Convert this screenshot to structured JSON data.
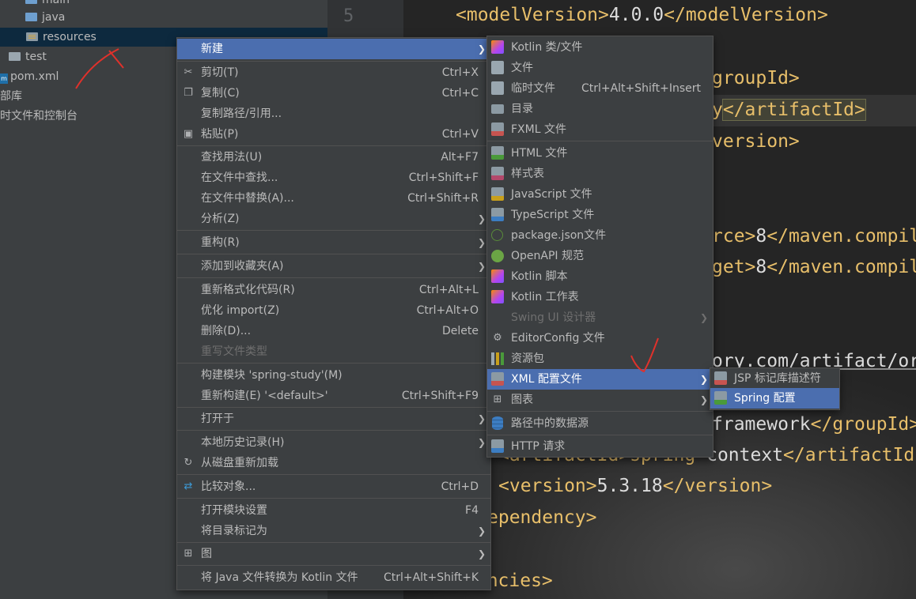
{
  "tree": {
    "items": [
      {
        "label": "main",
        "icon": "folder-icon"
      },
      {
        "label": "java",
        "icon": "folder-icon"
      },
      {
        "label": "resources",
        "icon": "resources-folder-icon"
      },
      {
        "label": "test",
        "icon": "folder-icon"
      },
      {
        "label": "pom.xml",
        "icon": "maven-file-icon"
      },
      {
        "label": "外部库",
        "icon": "library-icon"
      },
      {
        "label": "临时文件和控制台",
        "icon": "scratch-icon"
      }
    ]
  },
  "editor": {
    "line_number": "5",
    "lines": [
      {
        "open": "<modelVersion>",
        "text": "4.0.0",
        "close": "</modelVersion>"
      },
      {
        "frag": "groupId>"
      },
      {
        "frag_a": "y",
        "frag_b": "</artifactId>"
      },
      {
        "frag": "version>"
      },
      {
        "frag_a": "rce>",
        "num": "8",
        "frag_b": "</maven.compil"
      },
      {
        "frag_a": "get>",
        "num": "8",
        "frag_b": "</maven.compil"
      },
      {
        "frag": "ory.com/artifact/or"
      },
      {
        "frag_a": "framework",
        "frag_b": "</groupId>"
      },
      {
        "frag_a": "<artifactId>spring-",
        "frag_b": "context",
        "frag_c": "</artifactId"
      },
      {
        "open": "<version>",
        "text": "5.3.18",
        "close": "</version>"
      },
      {
        "frag": "ependency>"
      },
      {
        "frag": "dencies>"
      }
    ]
  },
  "context_menu": {
    "items": [
      {
        "label": "新建",
        "shortcut": "",
        "submenu": true
      },
      {
        "label": "剪切(T)",
        "shortcut": "Ctrl+X",
        "icon": "scissors-icon"
      },
      {
        "label": "复制(C)",
        "shortcut": "Ctrl+C",
        "icon": "copy-icon"
      },
      {
        "label": "复制路径/引用...",
        "shortcut": ""
      },
      {
        "label": "粘贴(P)",
        "shortcut": "Ctrl+V",
        "icon": "paste-icon"
      },
      {
        "label": "查找用法(U)",
        "shortcut": "Alt+F7"
      },
      {
        "label": "在文件中查找...",
        "shortcut": "Ctrl+Shift+F"
      },
      {
        "label": "在文件中替换(A)...",
        "shortcut": "Ctrl+Shift+R"
      },
      {
        "label": "分析(Z)",
        "shortcut": "",
        "submenu": true
      },
      {
        "label": "重构(R)",
        "shortcut": "",
        "submenu": true
      },
      {
        "label": "添加到收藏夹(A)",
        "shortcut": "",
        "submenu": true
      },
      {
        "label": "重新格式化代码(R)",
        "shortcut": "Ctrl+Alt+L"
      },
      {
        "label": "优化 import(Z)",
        "shortcut": "Ctrl+Alt+O"
      },
      {
        "label": "删除(D)...",
        "shortcut": "Delete"
      },
      {
        "label": "重写文件类型",
        "shortcut": "",
        "disabled": true
      },
      {
        "label": "构建模块 'spring-study'(M)",
        "shortcut": ""
      },
      {
        "label": "重新构建(E) '<default>'",
        "shortcut": "Ctrl+Shift+F9"
      },
      {
        "label": "打开于",
        "shortcut": "",
        "submenu": true
      },
      {
        "label": "本地历史记录(H)",
        "shortcut": "",
        "submenu": true
      },
      {
        "label": "从磁盘重新加载",
        "shortcut": "",
        "icon": "reload-icon"
      },
      {
        "label": "比较对象...",
        "shortcut": "Ctrl+D",
        "icon": "compare-icon"
      },
      {
        "label": "打开模块设置",
        "shortcut": "F4"
      },
      {
        "label": "将目录标记为",
        "shortcut": "",
        "submenu": true
      },
      {
        "label": "图",
        "shortcut": "",
        "submenu": true,
        "icon": "diagram-icon"
      },
      {
        "label": "将 Java 文件转换为 Kotlin 文件",
        "shortcut": "Ctrl+Alt+Shift+K"
      }
    ]
  },
  "new_menu": {
    "items": [
      {
        "label": "Kotlin 类/文件",
        "shortcut": "",
        "icon": "kotlin-icon"
      },
      {
        "label": "文件",
        "shortcut": "",
        "icon": "file-icon"
      },
      {
        "label": "临时文件",
        "shortcut": "Ctrl+Alt+Shift+Insert",
        "icon": "scratch-file-icon"
      },
      {
        "label": "目录",
        "shortcut": "",
        "icon": "folder-icon"
      },
      {
        "label": "FXML 文件",
        "shortcut": "",
        "icon": "fxml-icon"
      },
      {
        "label": "HTML 文件",
        "shortcut": "",
        "icon": "html-icon"
      },
      {
        "label": "样式表",
        "shortcut": "",
        "icon": "css-icon"
      },
      {
        "label": "JavaScript 文件",
        "shortcut": "",
        "icon": "js-icon"
      },
      {
        "label": "TypeScript 文件",
        "shortcut": "",
        "icon": "ts-icon"
      },
      {
        "label": "package.json文件",
        "shortcut": "",
        "icon": "nodejs-icon"
      },
      {
        "label": "OpenAPI 规范",
        "shortcut": "",
        "icon": "openapi-icon"
      },
      {
        "label": "Kotlin 脚本",
        "shortcut": "",
        "icon": "kotlin-script-icon"
      },
      {
        "label": "Kotlin 工作表",
        "shortcut": "",
        "icon": "kotlin-worksheet-icon"
      },
      {
        "label": "Swing UI 设计器",
        "shortcut": "",
        "disabled": true,
        "submenu": true
      },
      {
        "label": "EditorConfig 文件",
        "shortcut": "",
        "icon": "gear-icon"
      },
      {
        "label": "资源包",
        "shortcut": "",
        "icon": "resource-bundle-icon"
      },
      {
        "label": "XML 配置文件",
        "shortcut": "",
        "submenu": true,
        "icon": "xml-icon"
      },
      {
        "label": "图表",
        "shortcut": "",
        "submenu": true,
        "icon": "diagram-icon"
      },
      {
        "label": "路径中的数据源",
        "shortcut": "",
        "icon": "datasource-icon"
      },
      {
        "label": "HTTP 请求",
        "shortcut": "",
        "icon": "api-icon"
      }
    ]
  },
  "xml_menu": {
    "items": [
      {
        "label": "JSP 标记库描述符",
        "icon": "jsp-icon"
      },
      {
        "label": "Spring 配置",
        "icon": "spring-icon"
      }
    ]
  },
  "colors": {
    "selection": "#4b6eaf",
    "menu_bg": "#3c3f41",
    "tag": "#e8bf6a",
    "annotation": "#e0312b"
  }
}
